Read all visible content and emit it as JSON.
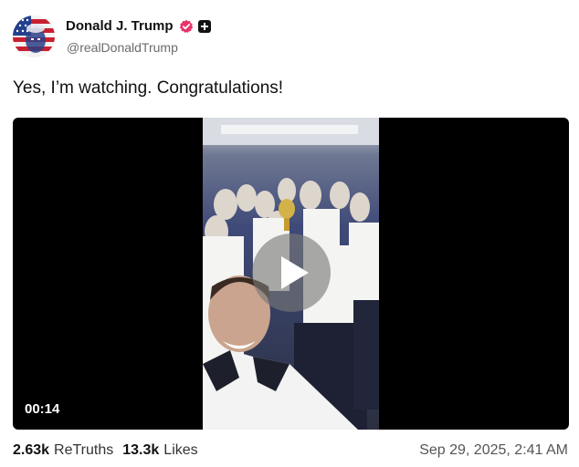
{
  "author": {
    "display_name": "Donald J. Trump",
    "handle": "@realDonaldTrump",
    "verified_badge_color": "#e8336a"
  },
  "post": {
    "text": "Yes, I’m watching. Congratulations!"
  },
  "video": {
    "duration": "00:14"
  },
  "stats": {
    "retruths_count": "2.63k",
    "retruths_label": "ReTruths",
    "likes_count": "13.3k",
    "likes_label": "Likes"
  },
  "timestamp": "Sep 29, 2025, 2:41 AM"
}
